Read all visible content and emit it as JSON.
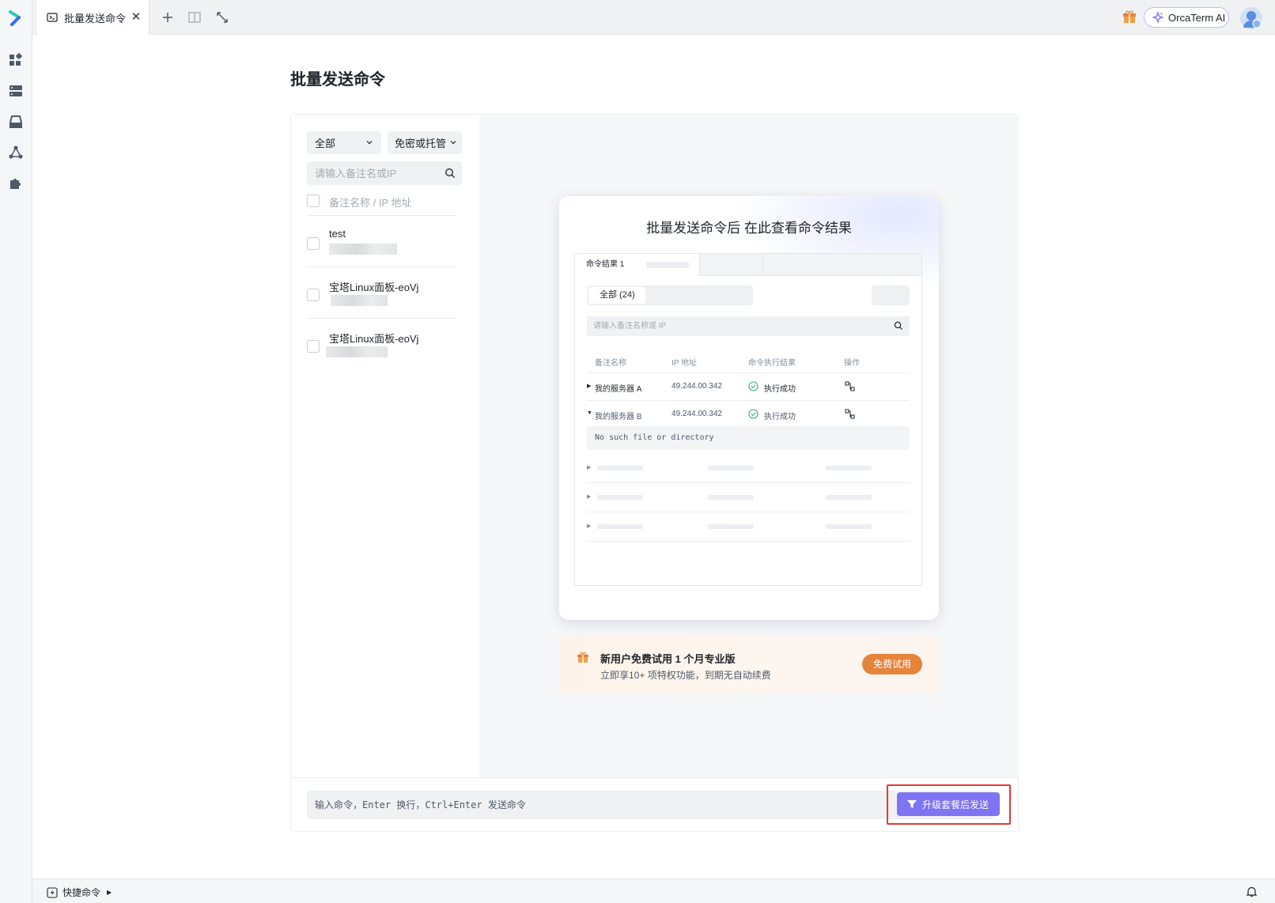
{
  "colors": {
    "accent": "#7f74f2",
    "orange": "#e5843b",
    "success": "#2bb673",
    "highlight": "#e53935"
  },
  "rail": {
    "icons": [
      "dashboard-icon",
      "server-icon",
      "storage-icon",
      "cluster-icon",
      "plugin-icon"
    ]
  },
  "tabs": [
    {
      "label": "批量发送命令",
      "icon": "terminal-icon"
    }
  ],
  "topbar": {
    "ai_label": "OrcaTerm AI"
  },
  "page": {
    "title": "批量发送命令"
  },
  "filters": {
    "scope": "全部",
    "auth": "免密或托管",
    "search_placeholder": "请输入备注名或IP"
  },
  "server_list": {
    "header": "备注名称 / IP 地址",
    "items": [
      {
        "name": "test"
      },
      {
        "name": "宝塔Linux面板-eoVj"
      },
      {
        "name": "宝塔Linux面板-eoVj"
      }
    ]
  },
  "preview": {
    "title": "批量发送命令后 在此查看命令结果",
    "tab_label": "命令结果 1",
    "segment_all": "全部 (24)",
    "search_placeholder": "请输入备注名称或 IP",
    "columns": [
      "备注名称",
      "IP 地址",
      "命令执行结果",
      "操作"
    ],
    "rows": [
      {
        "name": "我的服务器 A",
        "ip": "49.244.00.342",
        "status": "执行成功"
      },
      {
        "name": "我的服务器 B",
        "ip": "49.244.00.342",
        "status": "执行成功"
      }
    ],
    "output": "No such file or directory"
  },
  "promo": {
    "title": "新用户免费试用 1 个月专业版",
    "subtitle": "立即享10+ 项特权功能，到期无自动续费",
    "button": "免费试用"
  },
  "command": {
    "placeholder": "输入命令，Enter 换行，Ctrl+Enter 发送命令",
    "send_button": "升级套餐后发送"
  },
  "bottombar": {
    "quick_commands": "快捷命令"
  }
}
